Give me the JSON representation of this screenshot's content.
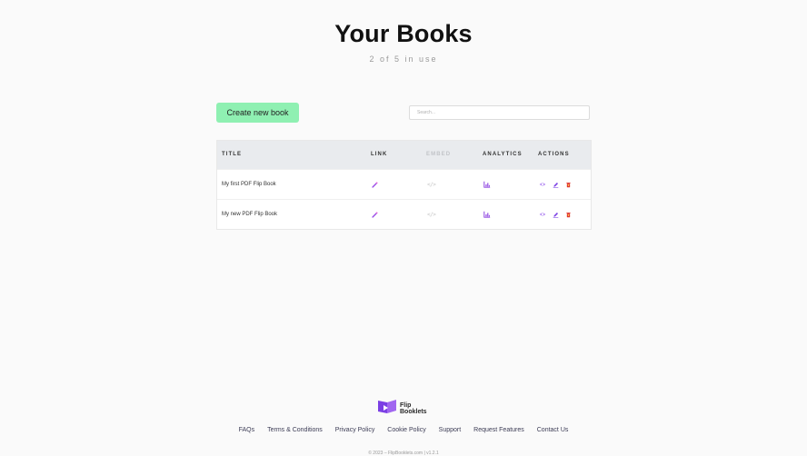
{
  "header": {
    "title": "Your Books",
    "usage": "2 of 5 in use"
  },
  "toolbar": {
    "create_label": "Create new book",
    "search_placeholder": "Search..."
  },
  "table": {
    "columns": [
      "TITLE",
      "LINK",
      "EMBED",
      "ANALYTICS",
      "ACTIONS"
    ],
    "rows": [
      {
        "title": "My first PDF Flip Book",
        "embed": "</>"
      },
      {
        "title": "My new PDF Flip Book",
        "embed": "</>"
      }
    ]
  },
  "brand": {
    "line1": "Flip",
    "line2": "Booklets",
    "accent": "#7b3fe4"
  },
  "footer": {
    "links": [
      "FAQs",
      "Terms & Conditions",
      "Privacy Policy",
      "Cookie Policy",
      "Support",
      "Request Features",
      "Contact Us"
    ],
    "copyright": "© 2023 – FlipBooklets.com | v1.2.1"
  },
  "icons": {
    "link": "magic-wand-icon",
    "embed": "code-icon",
    "analytics": "bar-chart-icon",
    "view": "eye-icon",
    "edit": "pencil-icon",
    "delete": "trash-icon"
  },
  "colors": {
    "create_button": "#8ff0b2",
    "header_bg": "#e9ebee",
    "delete": "#e0342c"
  }
}
